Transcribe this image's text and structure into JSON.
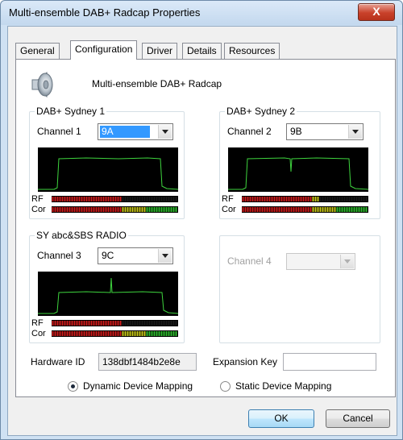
{
  "window": {
    "title": "Multi-ensemble DAB+ Radcap Properties",
    "close_label": "X"
  },
  "tabs": [
    "General",
    "Configuration",
    "Driver",
    "Details",
    "Resources"
  ],
  "device": {
    "name": "Multi-ensemble DAB+ Radcap",
    "icon": "speaker-icon"
  },
  "tuners": [
    {
      "group": "DAB+ Sydney 1",
      "channel_label": "Channel 1",
      "channel_value": "9A",
      "rf_label": "RF",
      "cor_label": "Cor",
      "rf_level": 0.55,
      "cor_level": 1.0
    },
    {
      "group": "DAB+ Sydney 2",
      "channel_label": "Channel 2",
      "channel_value": "9B",
      "rf_label": "RF",
      "cor_label": "Cor",
      "rf_level": 0.62,
      "cor_level": 1.0
    },
    {
      "group": "SY abc&SBS RADIO",
      "channel_label": "Channel 3",
      "channel_value": "9C",
      "rf_label": "RF",
      "cor_label": "Cor",
      "rf_level": 0.55,
      "cor_level": 1.0
    },
    {
      "group": "",
      "channel_label": "Channel 4",
      "channel_value": ""
    }
  ],
  "hardware": {
    "id_label": "Hardware ID",
    "id_value": "138dbf1484b2e8e",
    "expansion_label": "Expansion Key",
    "expansion_value": ""
  },
  "mapping": {
    "dynamic_label": "Dynamic Device Mapping",
    "static_label": "Static Device Mapping",
    "selected": "dynamic"
  },
  "buttons": {
    "ok": "OK",
    "cancel": "Cancel"
  },
  "colors": {
    "meter_green": "#2dbb2d",
    "meter_yellow": "#c8c818",
    "meter_red": "#d11b1b",
    "selection": "#3399ff",
    "scope_trace": "#3ed43e"
  }
}
